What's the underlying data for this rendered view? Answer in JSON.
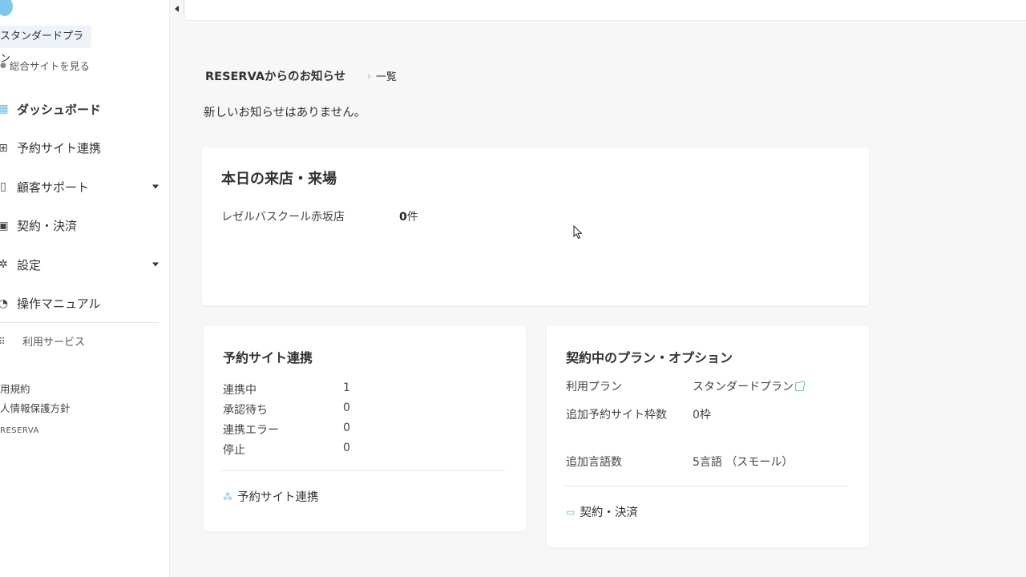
{
  "sidebar": {
    "plan_chip": "スタンダードプラン",
    "site_link": "総合サイトを見る",
    "items": [
      {
        "label": "ダッシュボード",
        "icon": "dashboard-icon",
        "active": true,
        "expandable": false
      },
      {
        "label": "予約サイト連携",
        "icon": "sync-icon",
        "active": false,
        "expandable": false
      },
      {
        "label": "顧客サポート",
        "icon": "support-icon",
        "active": false,
        "expandable": true
      },
      {
        "label": "契約・決済",
        "icon": "contract-icon",
        "active": false,
        "expandable": false
      },
      {
        "label": "設定",
        "icon": "gear-icon",
        "active": false,
        "expandable": true
      },
      {
        "label": "操作マニュアル",
        "icon": "manual-icon",
        "active": false,
        "expandable": false
      }
    ],
    "services_label": "利用サービス",
    "terms": "用規約",
    "privacy": "人情報保護方針",
    "brand": "RESERVA"
  },
  "notice": {
    "title": "RESERVAからのお知らせ",
    "more": "一覧",
    "empty": "新しいお知らせはありません。"
  },
  "today": {
    "title": "本日の来店・来場",
    "store_name": "レゼルバスクール赤坂店",
    "count": "0",
    "count_unit": "件"
  },
  "sync": {
    "title": "予約サイト連携",
    "rows": [
      {
        "label": "連携中",
        "value": "1"
      },
      {
        "label": "承認待ち",
        "value": "0"
      },
      {
        "label": "連携エラー",
        "value": "0"
      },
      {
        "label": "停止",
        "value": "0"
      }
    ],
    "link": "予約サイト連携"
  },
  "plan": {
    "title": "契約中のプラン・オプション",
    "rows": [
      {
        "label": "利用プラン",
        "value": "スタンダードプラン"
      },
      {
        "label": "追加予約サイト枠数",
        "value": "0枠"
      },
      {
        "label": "追加言語数",
        "value": "5言語 （スモール）"
      }
    ],
    "link": "契約・決済"
  },
  "colors": {
    "accent": "#6bbbe0",
    "chip_bg": "#eef3f9",
    "page_bg": "#f7f7f8"
  }
}
